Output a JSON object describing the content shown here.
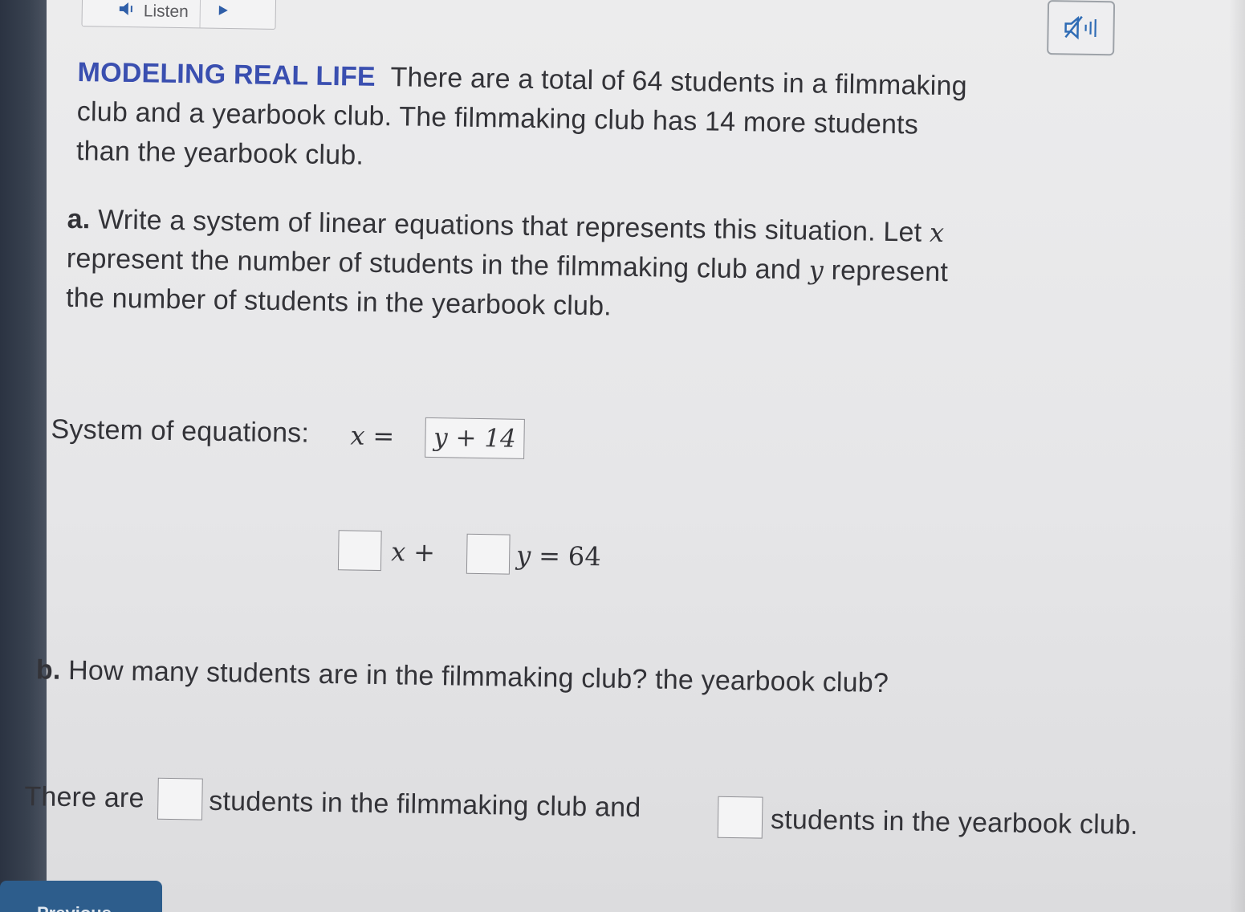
{
  "toolbar": {
    "listen_label": "Listen"
  },
  "problem": {
    "heading": "MODELING REAL LIFE",
    "line1": "There are a total of 64 students in a filmmaking",
    "line2": "club and a yearbook club. The filmmaking club has 14 more students",
    "line3": "than the yearbook club."
  },
  "part_a": {
    "label": "a.",
    "line1_text": "Write a system of linear equations that represents this situation. Let",
    "var_x": "x",
    "line2_text_before": "represent the number of students in the filmmaking club and",
    "var_y": "y",
    "line2_text_after": "represent",
    "line3": "the number of students in the yearbook club."
  },
  "system": {
    "label": "System of equations:",
    "eq1_lhs": "x",
    "equals": "=",
    "eq1_answer": "y + 14",
    "eq2_coef_x_value": "",
    "eq2_x": "x",
    "plus": "+",
    "eq2_coef_y_value": "",
    "eq2_y": "y",
    "eq2_rhs": "64"
  },
  "part_b": {
    "label": "b.",
    "question": "How many students are in the filmmaking club? the yearbook club?",
    "answer_prefix": "There are",
    "answer_middle": "students in the filmmaking club and",
    "answer_suffix": "students in the yearbook club.",
    "filmmaking_value": "",
    "yearbook_value": ""
  },
  "nav": {
    "previous_label": "Previous"
  },
  "colors": {
    "heading": "#3a4fb0",
    "previous_button": "#2d5d8c"
  }
}
